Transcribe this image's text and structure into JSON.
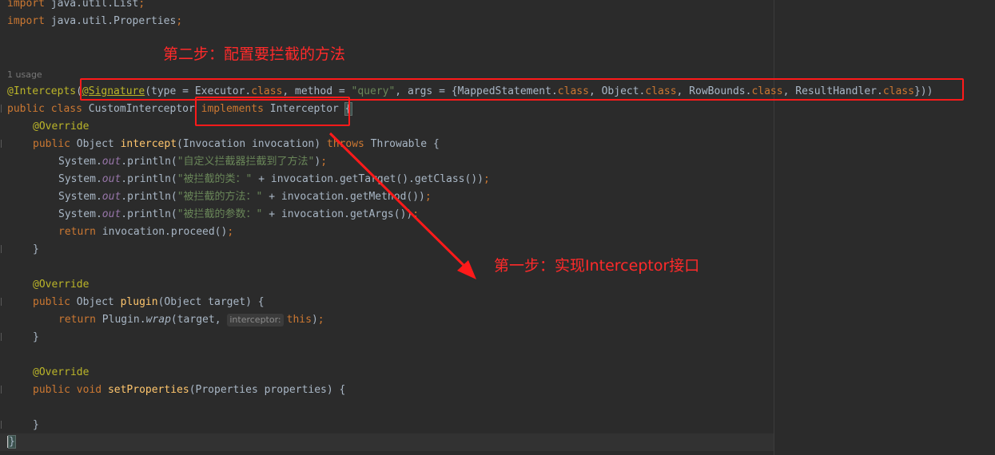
{
  "editor": {
    "usage_hint": "1 usage",
    "param_hint": "interceptor:",
    "lines": {
      "import_list_kw": "import",
      "import_list_rest": " java.util.List",
      "import_props_kw": "import",
      "import_props_rest": " java.util.Properties",
      "anno_intercepts": "@Intercepts",
      "anno_signature": "@Signature",
      "sig_part1": "(type = Executor.",
      "sig_class": "class",
      "sig_part2": ", method = ",
      "sig_query": "\"query\"",
      "sig_part3": ", args = {MappedStatement.",
      "sig_part4": ", Object.",
      "sig_part5": ", RowBounds.",
      "sig_part6": ", ResultHandler.",
      "sig_end": "}))",
      "class_kw": "public class",
      "class_name": " CustomInterceptor ",
      "implements_kw": "implements",
      "interface_name": " Interceptor ",
      "open_brace": "{",
      "override": "@Override",
      "public_kw": "public",
      "object_type": " Object ",
      "intercept_name": "intercept",
      "intercept_params": "(Invocation invocation) ",
      "throws_kw": "throws",
      "throwable": " Throwable {",
      "sys": "System.",
      "out": "out",
      "println": ".println(",
      "str1": "\"自定义拦截器拦截到了方法\"",
      "str2": "\"被拦截的类：\"",
      "str2_rest": " + invocation.getTarget().getClass())",
      "str3": "\"被拦截的方法：\"",
      "str3_rest": " + invocation.getMethod())",
      "str4": "\"被拦截的参数：\"",
      "str4_rest": " + invocation.getArgs())",
      "return_kw": "return",
      "proceed": " invocation.proceed()",
      "semicolon": ";",
      "paren_close": ")",
      "close_brace": "}",
      "plugin_name": "plugin",
      "plugin_params": "(Object target) {",
      "plugin_wrap_pre": " Plugin.",
      "plugin_wrap": "wrap",
      "plugin_wrap_args": "(target, ",
      "this_kw": "this",
      "void_kw": " void ",
      "setprops_name": "setProperties",
      "setprops_params": "(Properties properties) {"
    }
  },
  "annotations": {
    "step2": "第二步：配置要拦截的方法",
    "step1": "第一步：实现Interceptor接口"
  }
}
